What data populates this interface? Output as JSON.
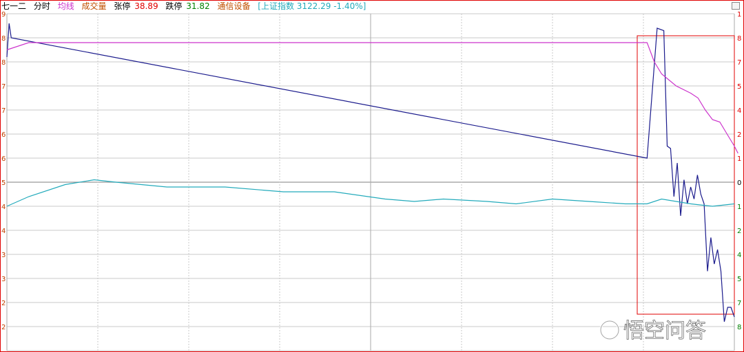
{
  "header": {
    "stock_name": "七一二",
    "mode": "分时",
    "avg_label": "均线",
    "volume_label": "成交量",
    "limit_up_label": "张停",
    "limit_up_value": "38.89",
    "limit_down_label": "跌停",
    "limit_down_value": "31.82",
    "sector": "通信设备",
    "index_info": "[上证指数 3122.29 -1.40%]"
  },
  "watermark": "悟空问答",
  "colors": {
    "price": "#1a1a8c",
    "avg": "#cc33cc",
    "index": "#22aabb",
    "grid": "#c8c8c8",
    "frame": "#e00000",
    "up": "#e00000",
    "down": "#008000"
  },
  "chart_data": {
    "type": "line",
    "xlabel": "",
    "ylabel": "",
    "left_ticks": [
      "9",
      "8",
      "8",
      "7",
      "7",
      "6",
      "6",
      "5",
      "4",
      "4",
      "3",
      "3",
      "2",
      "2"
    ],
    "right_ticks": [
      "1",
      "8",
      "7",
      "5",
      "4",
      "2",
      "1",
      "0",
      "1",
      "2",
      "4",
      "5",
      "7",
      "8"
    ],
    "ylim": [
      0,
      14
    ],
    "series": [
      {
        "role": "price",
        "points": [
          [
            0,
            8.0
          ],
          [
            3,
            13.4
          ],
          [
            5,
            13.3
          ],
          [
            6,
            8.5
          ],
          [
            7,
            8.4
          ],
          [
            8,
            6.4
          ],
          [
            9,
            7.8
          ],
          [
            10,
            5.6
          ],
          [
            11,
            7.1
          ],
          [
            12,
            6.1
          ],
          [
            13,
            6.8
          ],
          [
            14,
            6.3
          ],
          [
            15,
            7.3
          ],
          [
            16,
            6.5
          ],
          [
            17,
            6.1
          ],
          [
            18,
            3.3
          ],
          [
            19,
            4.7
          ],
          [
            20,
            3.6
          ],
          [
            21,
            4.2
          ],
          [
            22,
            3.3
          ],
          [
            23,
            1.2
          ],
          [
            24,
            1.8
          ],
          [
            25,
            1.8
          ],
          [
            26,
            1.4
          ]
        ]
      },
      {
        "role": "avg",
        "points": [
          [
            0,
            12.5
          ],
          [
            3,
            12.8
          ],
          [
            40,
            12.8
          ],
          [
            85,
            12.8
          ],
          [
            88,
            12.8
          ],
          [
            89,
            12.0
          ],
          [
            90,
            11.5
          ],
          [
            92,
            11.0
          ],
          [
            94,
            10.7
          ],
          [
            95,
            10.5
          ],
          [
            96,
            10.0
          ],
          [
            97,
            9.6
          ],
          [
            98,
            9.5
          ],
          [
            99,
            9.0
          ],
          [
            100,
            8.5
          ],
          [
            100.5,
            8.2
          ]
        ]
      },
      {
        "role": "index",
        "points": [
          [
            0,
            6.0
          ],
          [
            3,
            6.4
          ],
          [
            8,
            6.9
          ],
          [
            12,
            7.1
          ],
          [
            15,
            7.0
          ],
          [
            22,
            6.8
          ],
          [
            30,
            6.8
          ],
          [
            38,
            6.6
          ],
          [
            45,
            6.6
          ],
          [
            52,
            6.3
          ],
          [
            56,
            6.2
          ],
          [
            60,
            6.3
          ],
          [
            66,
            6.2
          ],
          [
            70,
            6.1
          ],
          [
            75,
            6.3
          ],
          [
            80,
            6.2
          ],
          [
            85,
            6.1
          ],
          [
            88,
            6.1
          ],
          [
            90,
            6.3
          ],
          [
            94,
            6.1
          ],
          [
            97,
            6.0
          ],
          [
            100,
            6.1
          ]
        ]
      }
    ]
  }
}
